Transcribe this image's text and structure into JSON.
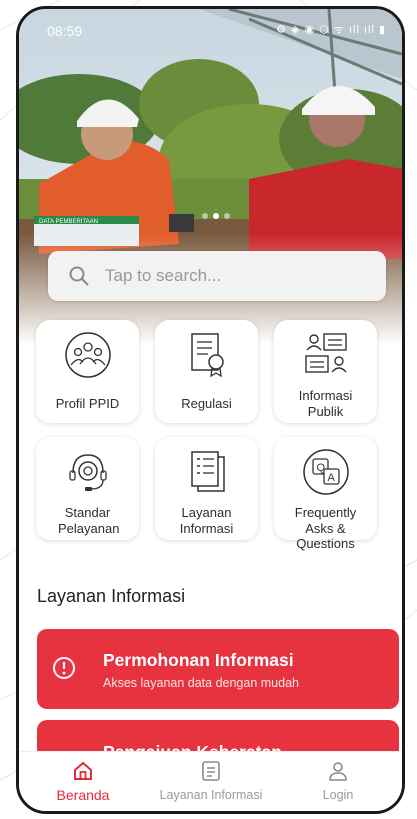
{
  "status_bar": {
    "time": "08:59",
    "icons": "⚙ ◈ ◉ ⬡ ᯤ ıll ıll ▮"
  },
  "search": {
    "placeholder": "Tap to search..."
  },
  "menu": [
    {
      "label": "Profil PPID",
      "icon": "people-group-icon"
    },
    {
      "label": "Regulasi",
      "icon": "document-certificate-icon"
    },
    {
      "label": "Informasi Publik",
      "icon": "public-information-icon"
    },
    {
      "label": "Standar Pelayanan",
      "icon": "service-gear-headset-icon"
    },
    {
      "label": "Layanan Informasi",
      "icon": "documents-list-icon"
    },
    {
      "label": "Frequently Asks & Questions",
      "icon": "faq-chat-icon"
    }
  ],
  "section": {
    "title": "Layanan Informasi"
  },
  "services": [
    {
      "title": "Permohonan Informasi",
      "subtitle": "Akses layanan data dengan mudah",
      "icon": "alert-circle-icon"
    },
    {
      "title": "Pengajuan Keberatan",
      "icon": "document-icon"
    }
  ],
  "nav": [
    {
      "label": "Beranda",
      "icon": "home-icon",
      "active": true
    },
    {
      "label": "Layanan Informasi",
      "icon": "list-doc-icon",
      "active": false
    },
    {
      "label": "Login",
      "icon": "user-icon",
      "active": false
    }
  ],
  "hero": {
    "sign_text": "DATA PEMBERITAAN"
  },
  "colors": {
    "accent": "#e7333f",
    "nav_active": "#e02d3a",
    "tile_bg": "#ffffff"
  }
}
